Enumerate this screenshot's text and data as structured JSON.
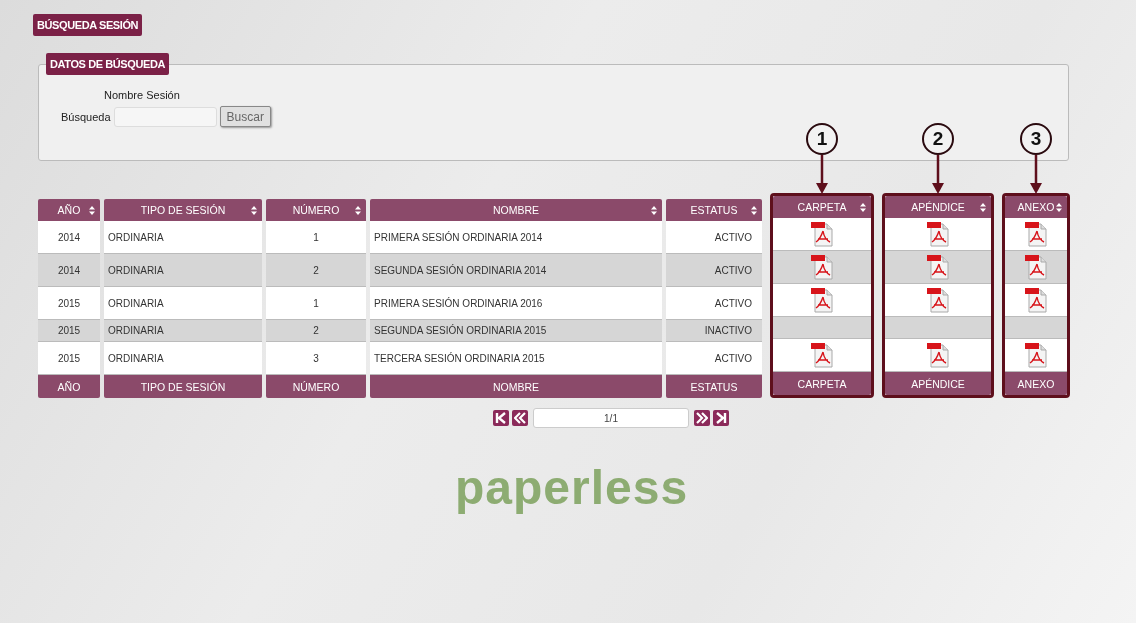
{
  "page_title": "BÚSQUEDA SESIÓN",
  "search_panel": {
    "legend": "DATOS DE BÚSQUEDA",
    "field_heading": "Nombre Sesión",
    "label": "Búsqueda",
    "button": "Buscar"
  },
  "table": {
    "columns": [
      {
        "label": "AÑO",
        "kind": "centered"
      },
      {
        "label": "TIPO DE SESIÓN",
        "kind": "text"
      },
      {
        "label": "NÚMERO",
        "kind": "centered"
      },
      {
        "label": "NOMBRE",
        "kind": "text"
      },
      {
        "label": "ESTATUS",
        "kind": "status"
      },
      {
        "label": "CARPETA",
        "kind": "file",
        "annotation": "1"
      },
      {
        "label": "APÉNDICE",
        "kind": "file",
        "annotation": "2"
      },
      {
        "label": "ANEXO",
        "kind": "file",
        "annotation": "3"
      }
    ],
    "rows": [
      {
        "cells": [
          "2014",
          "ORDINARIA",
          "1",
          "PRIMERA SESIÓN ORDINARIA 2014",
          "ACTIVO",
          true,
          true,
          true
        ]
      },
      {
        "cells": [
          "2014",
          "ORDINARIA",
          "2",
          "SEGUNDA SESIÓN ORDINARIA 2014",
          "ACTIVO",
          true,
          true,
          true
        ]
      },
      {
        "cells": [
          "2015",
          "ORDINARIA",
          "1",
          "PRIMERA SESIÓN ORDINARIA 2016",
          "ACTIVO",
          true,
          true,
          true
        ]
      },
      {
        "cells": [
          "2015",
          "ORDINARIA",
          "2",
          "SEGUNDA SESIÓN ORDINARIA 2015",
          "INACTIVO",
          false,
          false,
          false
        ]
      },
      {
        "cells": [
          "2015",
          "ORDINARIA",
          "3",
          "TERCERA SESIÓN ORDINARIA 2015",
          "ACTIVO",
          true,
          true,
          true
        ]
      }
    ],
    "footer": [
      "AÑO",
      "TIPO DE SESIÓN",
      "NÚMERO",
      "NOMBRE",
      "ESTATUS",
      "CARPETA",
      "APÉNDICE",
      "ANEXO"
    ]
  },
  "pagination": {
    "page": "1/1"
  },
  "logo": "paperless"
}
